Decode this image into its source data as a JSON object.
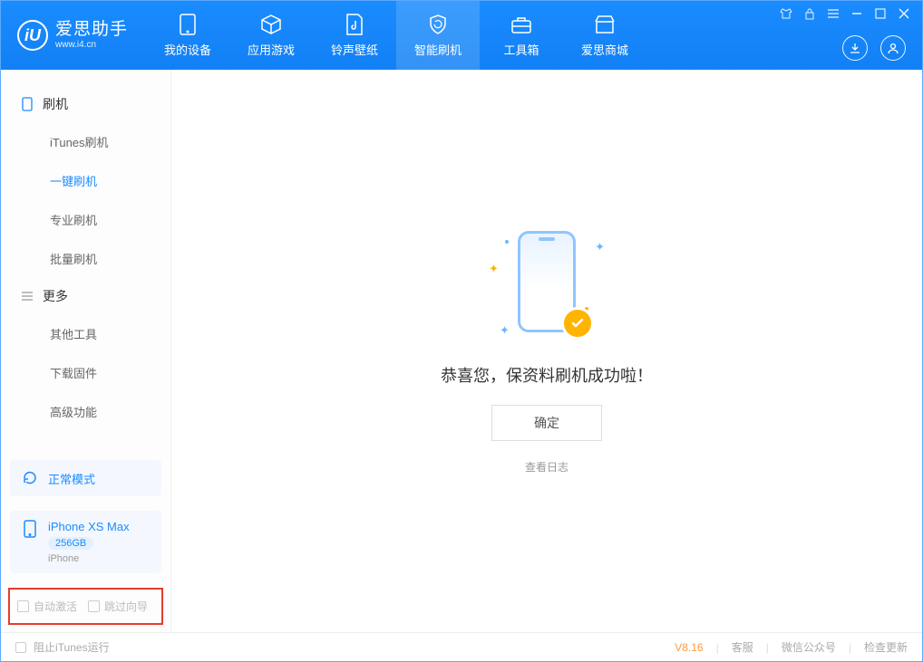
{
  "app": {
    "logo_label": "iU",
    "title": "爱思助手",
    "subtitle": "www.i4.cn"
  },
  "nav": [
    {
      "label": "我的设备"
    },
    {
      "label": "应用游戏"
    },
    {
      "label": "铃声壁纸"
    },
    {
      "label": "智能刷机"
    },
    {
      "label": "工具箱"
    },
    {
      "label": "爱思商城"
    }
  ],
  "sidebar": {
    "group1": {
      "title": "刷机",
      "items": [
        {
          "label": "iTunes刷机"
        },
        {
          "label": "一键刷机"
        },
        {
          "label": "专业刷机"
        },
        {
          "label": "批量刷机"
        }
      ]
    },
    "group2": {
      "title": "更多",
      "items": [
        {
          "label": "其他工具"
        },
        {
          "label": "下载固件"
        },
        {
          "label": "高级功能"
        }
      ]
    }
  },
  "mode": {
    "label": "正常模式"
  },
  "device": {
    "name": "iPhone XS Max",
    "storage": "256GB",
    "type": "iPhone"
  },
  "options": {
    "auto_activate": "自动激活",
    "skip_guide": "跳过向导"
  },
  "main": {
    "success_text": "恭喜您，保资料刷机成功啦！",
    "ok_button": "确定",
    "view_log": "查看日志"
  },
  "footer": {
    "block_itunes": "阻止iTunes运行",
    "version": "V8.16",
    "support": "客服",
    "wechat": "微信公众号",
    "check_update": "检查更新"
  }
}
